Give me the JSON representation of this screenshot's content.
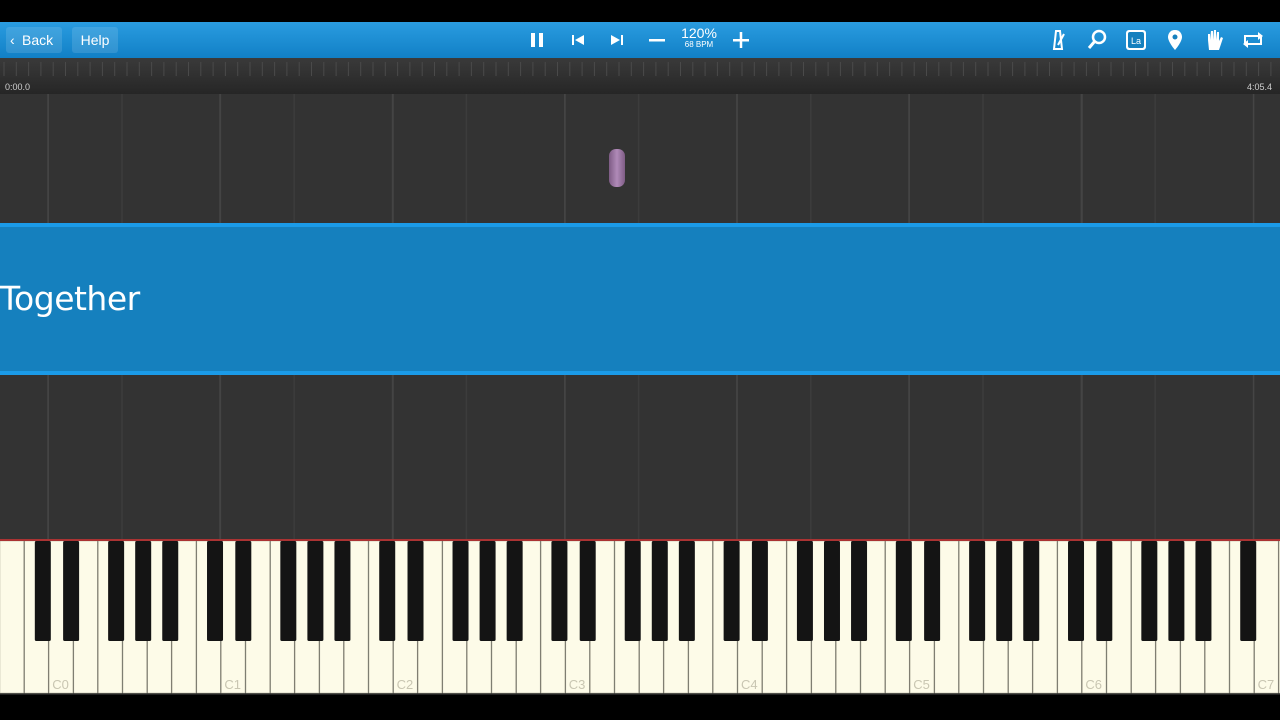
{
  "toolbar": {
    "back_label": "Back",
    "help_label": "Help",
    "zoom_percent": "120%",
    "bpm": "68 BPM",
    "icons": [
      "pause-icon",
      "skip-back-icon",
      "skip-forward-icon",
      "minus-icon",
      "plus-icon",
      "metronome-icon",
      "magnifier-icon",
      "note-label-icon",
      "map-pin-icon",
      "hand-icon",
      "loop-icon"
    ]
  },
  "timeline": {
    "start_time": "0:00.0",
    "end_time": "4:05.4"
  },
  "banner": {
    "title": "Together"
  },
  "keyboard": {
    "octave_labels": [
      "C0",
      "C1",
      "C2",
      "C3",
      "C4",
      "C5",
      "C6",
      "C7"
    ],
    "colors": {
      "white_key": "#fdfbe8",
      "black_key": "#141414",
      "note": "#9b77a3",
      "accent": "#1580be"
    }
  }
}
